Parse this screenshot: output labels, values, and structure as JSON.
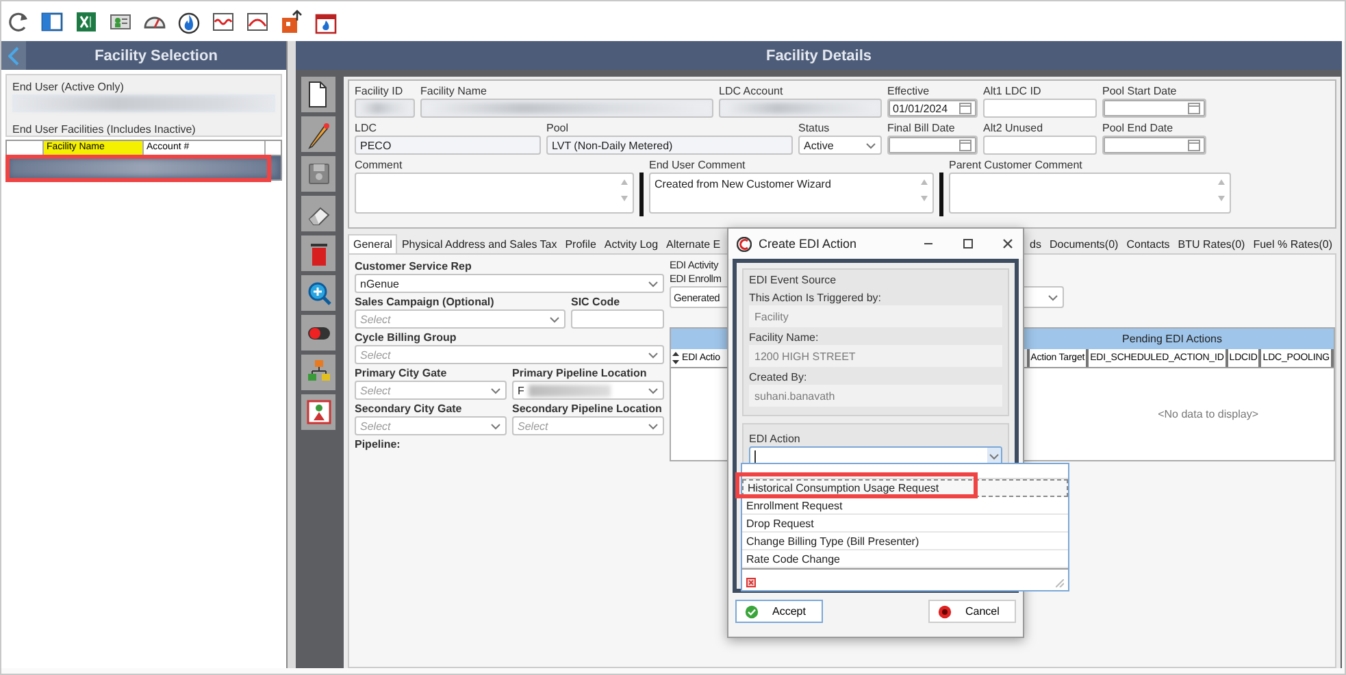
{
  "left_panel": {
    "title": "Facility Selection",
    "end_user_label": "End User (Active Only)",
    "facilities_label": "End User Facilities (Includes Inactive)",
    "columns": [
      {
        "label": "Facility Name",
        "highlighted": true
      },
      {
        "label": "Account #",
        "highlighted": false
      }
    ]
  },
  "details": {
    "title": "Facility Details",
    "header_rows": [
      [
        {
          "label": "Facility ID",
          "kind": "blurred"
        },
        {
          "label": "Facility Name",
          "kind": "blurred"
        },
        {
          "label": "LDC Account",
          "kind": "blurred"
        },
        {
          "label": "Effective",
          "kind": "date",
          "value": "01/01/2024"
        },
        {
          "label": "Alt1  LDC ID",
          "kind": "text"
        },
        {
          "label": "Pool Start Date",
          "kind": "date"
        }
      ],
      [
        {
          "label": "LDC",
          "kind": "text",
          "value": "PECO"
        },
        {
          "label": "Pool",
          "kind": "text",
          "value": "LVT (Non-Daily Metered)"
        },
        {
          "label": "Status",
          "kind": "select",
          "value": "Active"
        },
        {
          "label": "Final Bill Date",
          "kind": "date"
        },
        {
          "label": "Alt2  Unused",
          "kind": "text"
        },
        {
          "label": "Pool End Date",
          "kind": "date"
        }
      ],
      [
        {
          "label": "Comment",
          "kind": "memo"
        },
        {
          "label": "End User Comment",
          "kind": "memo",
          "value": "Created from New Customer Wizard"
        },
        {
          "label": "Parent Customer Comment",
          "kind": "memo"
        }
      ]
    ],
    "tabs": [
      {
        "label": "General",
        "selected": true
      },
      {
        "label": "Physical Address and Sales Tax",
        "selected": false
      },
      {
        "label": "Profile",
        "selected": false
      },
      {
        "label": "Actvity Log",
        "selected": false
      },
      {
        "label": "Alternate E",
        "selected": false
      }
    ],
    "tabs_right_of_dialog": [
      {
        "label": "ds",
        "selected": false
      },
      {
        "label": "Documents(0)",
        "selected": false
      },
      {
        "label": "Contacts",
        "selected": false
      },
      {
        "label": "BTU Rates(0)",
        "selected": false
      },
      {
        "label": "Fuel % Rates(0)",
        "selected": false
      }
    ],
    "general_rows": [
      [
        {
          "label": "Customer Service Rep",
          "kind": "select",
          "value": "nGenue"
        }
      ],
      [
        {
          "label": "Sales Campaign (Optional)",
          "kind": "select",
          "placeholder": "Select"
        },
        {
          "label": "SIC Code",
          "kind": "text"
        }
      ],
      [
        {
          "label": "Cycle Billing Group",
          "kind": "select",
          "placeholder": "Select"
        }
      ],
      [
        {
          "label": "Primary City Gate",
          "kind": "select",
          "placeholder": "Select"
        },
        {
          "label": "Primary Pipeline Location",
          "kind": "select",
          "value": "F",
          "redacted": true
        }
      ],
      [
        {
          "label": "Secondary City Gate",
          "kind": "select",
          "placeholder": "Select"
        },
        {
          "label": "Secondary Pipeline Location",
          "kind": "select",
          "placeholder": "Select"
        }
      ],
      [
        {
          "label": "Pipeline:",
          "kind": "label"
        }
      ]
    ],
    "edi": {
      "activity_label": "EDI Activity",
      "enrollment_label": "EDI Enrollm",
      "enrollment_value": "Generated",
      "band": "Pending EDI Actions",
      "columns": [
        "EDI Actio",
        "Action Target",
        "EDI_SCHEDULED_ACTION_ID",
        "LDCID",
        "LDC_POOLING"
      ],
      "empty_text": "<No data to display>"
    }
  },
  "dialog": {
    "title": "Create EDI Action",
    "source_group": "EDI Event Source",
    "fields": [
      {
        "label": "This Action Is Triggered by:",
        "value": "Facility"
      },
      {
        "label": "Facility Name:",
        "value": "1200 HIGH STREET"
      },
      {
        "label": "Created By:",
        "value": "suhani.banavath"
      }
    ],
    "action_label": "EDI Action",
    "options": [
      {
        "label": "Historical Consumption Usage Request",
        "selected": true
      },
      {
        "label": "Enrollment Request",
        "selected": false
      },
      {
        "label": "Drop Request",
        "selected": false
      },
      {
        "label": "Change Billing Type (Bill Presenter)",
        "selected": false
      },
      {
        "label": "Rate Code Change",
        "selected": false
      }
    ],
    "buttons": [
      {
        "label": "Accept",
        "kind": "accept"
      },
      {
        "label": "Cancel",
        "kind": "cancel"
      }
    ]
  }
}
